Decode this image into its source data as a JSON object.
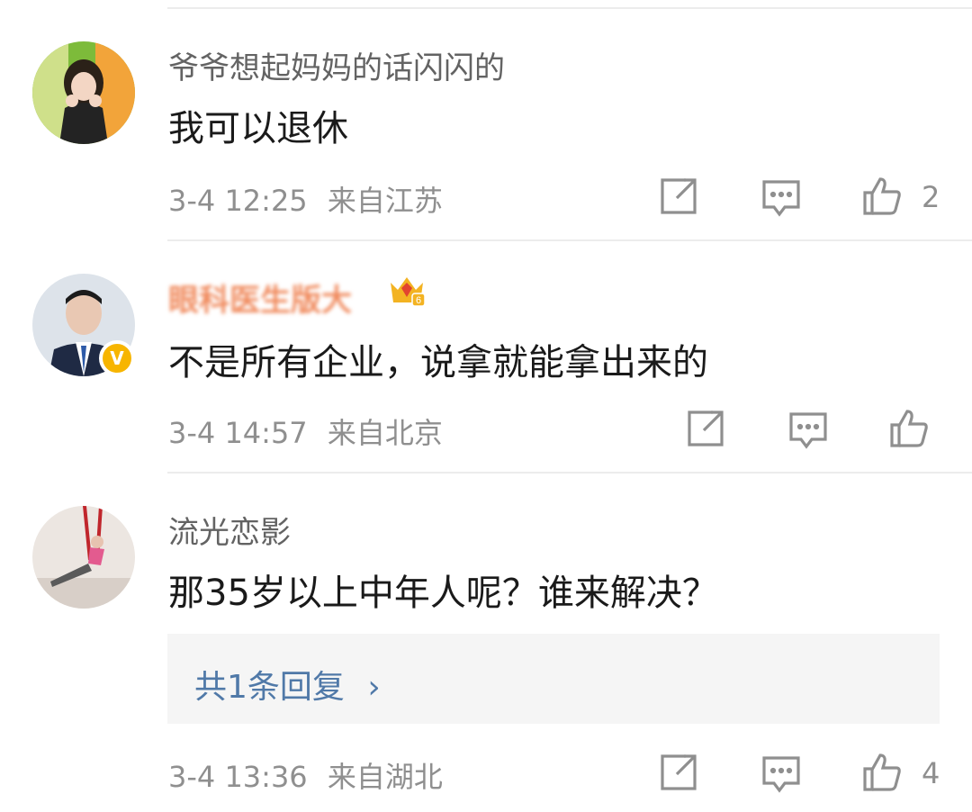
{
  "comments": [
    {
      "username": "爷爷想起妈妈的话闪闪的",
      "text": "我可以退休",
      "time": "3-4 12:25",
      "location": "来自江苏",
      "likes": "2"
    },
    {
      "username": "眼科医生版大",
      "verified_badge": "V",
      "crown_level": "6",
      "text": "不是所有企业，说拿就能拿出来的",
      "time": "3-4 14:57",
      "location": "来自北京",
      "likes": ""
    },
    {
      "username": "流光恋影",
      "text": "那35岁以上中年人呢？谁来解决？",
      "reply_link": "共1条回复",
      "reply_arrow": "›",
      "time": "3-4 13:36",
      "location": "来自湖北",
      "likes": "4"
    }
  ],
  "icons": {
    "repost": "repost-icon",
    "comment": "comment-icon",
    "like": "like-icon"
  },
  "colors": {
    "meta_gray": "#8f8f8f",
    "username_gray": "#636363",
    "reply_blue": "#5079a8",
    "badge_gold": "#f7b500"
  }
}
